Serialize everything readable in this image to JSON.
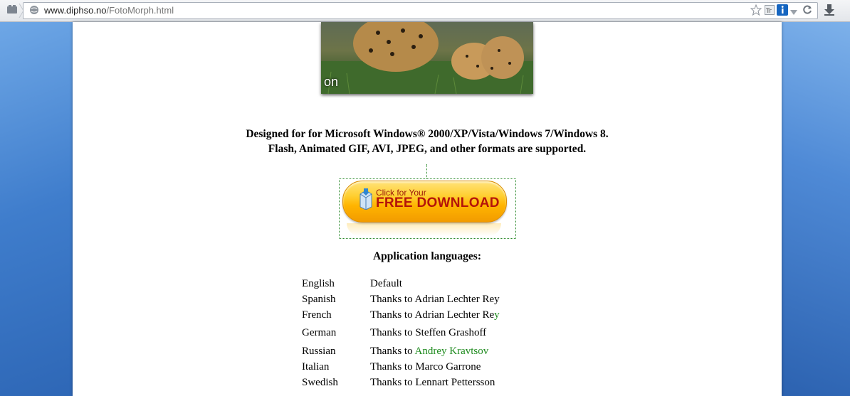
{
  "browser": {
    "url_host": "www.diphso.no",
    "url_path": "/FotoMorph.html"
  },
  "hero": {
    "caption": "on"
  },
  "description": {
    "line1": "Designed for for Microsoft Windows® 2000/XP/Vista/Windows 7/Windows 8.",
    "line2": "Flash, Animated GIF, AVI, JPEG, and other formats are supported."
  },
  "download": {
    "small": "Click for Your",
    "big": "FREE DOWNLOAD"
  },
  "languages": {
    "title": "Application languages:",
    "rows": [
      {
        "name": "English",
        "credit": "Default",
        "link": ""
      },
      {
        "name": "Spanish",
        "credit": "Thanks to Adrian Lechter Rey",
        "link": ""
      },
      {
        "name": "French",
        "credit": "Thanks to Adrian Lechter Re",
        "link": "y"
      },
      {
        "name": "German",
        "credit": "Thanks to Steffen Grashoff",
        "link": ""
      },
      {
        "name": "Russian",
        "credit": "Thanks to ",
        "link": "Andrey Kravtsov"
      },
      {
        "name": "Italian",
        "credit": "Thanks to Marco Garrone",
        "link": ""
      },
      {
        "name": "Swedish",
        "credit": "Thanks to Lennart Pettersson",
        "link": ""
      }
    ]
  },
  "colors": {
    "link_green": "#1d8a1d",
    "download_text": "#b4140a"
  }
}
